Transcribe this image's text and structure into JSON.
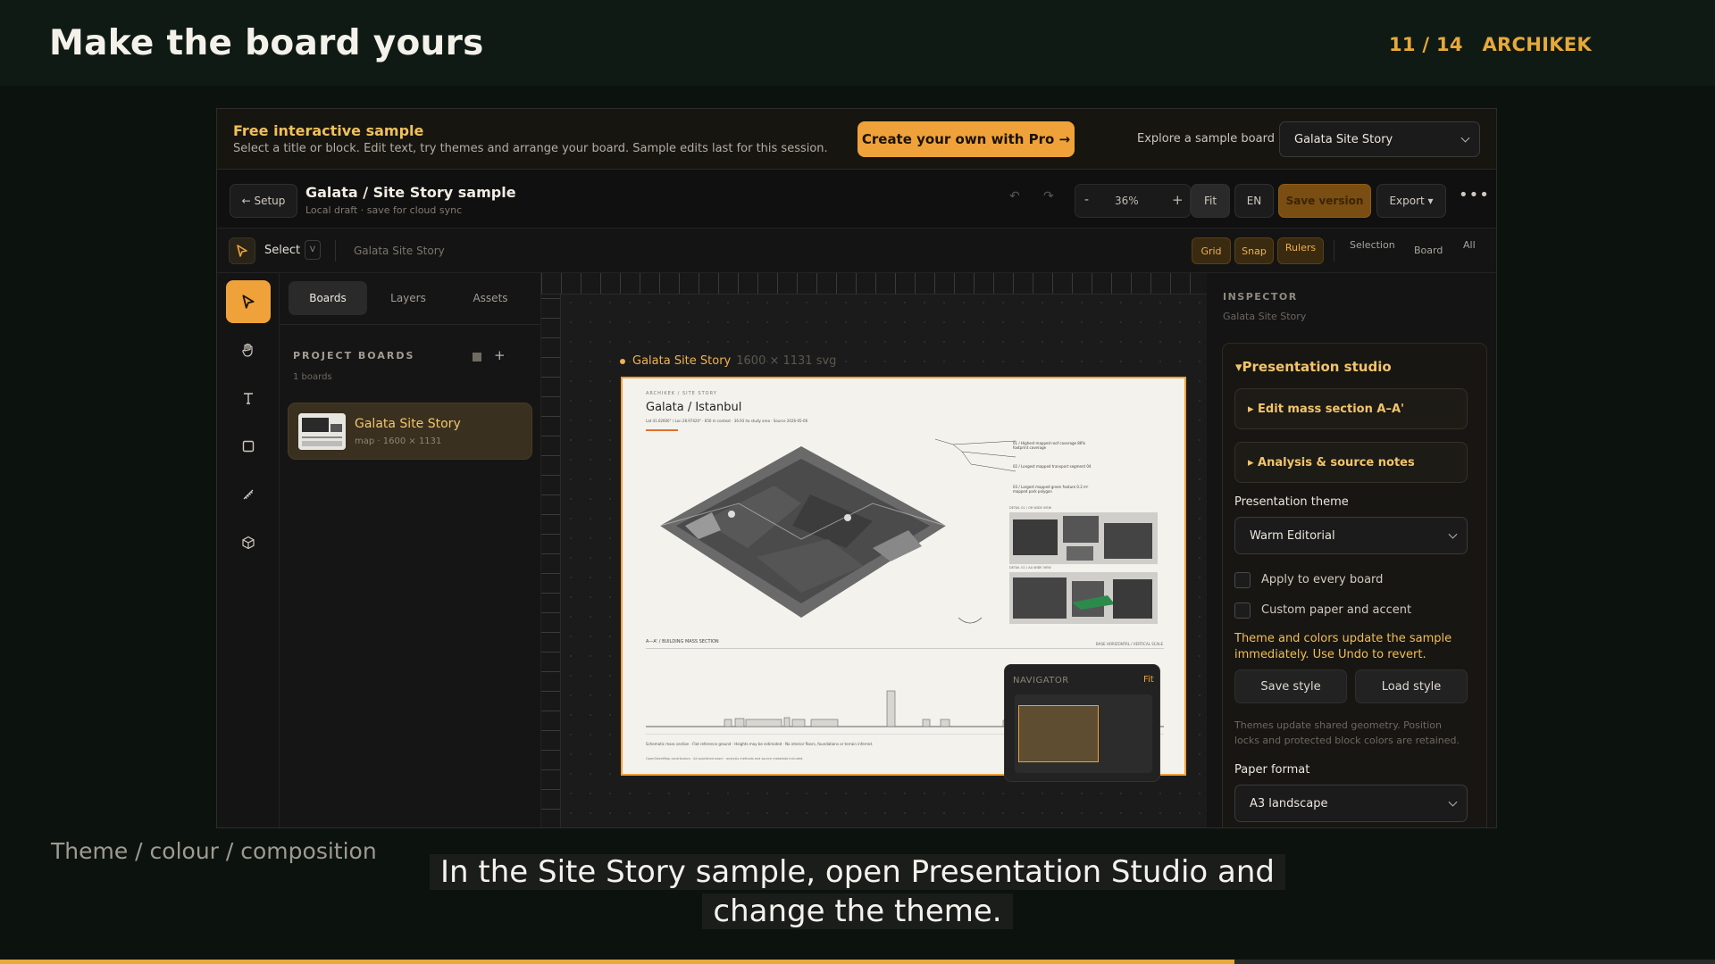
{
  "slide": {
    "title": "Make the board yours",
    "counter": "11 / 14",
    "brand": "ARCHIKEK",
    "subtitle": "Theme / colour / composition",
    "caption": "In the Site Story sample, open Presentation Studio and change the theme.",
    "progress": 0.72
  },
  "banner": {
    "title": "Free interactive sample",
    "description": "Select a title or block. Edit text, try themes and arrange your board. Sample edits last for this session.",
    "pro_button": "Create your own with Pro →",
    "explore_label": "Explore a sample board",
    "sample_select": "Galata Site Story"
  },
  "topbar": {
    "setup_button": "← Setup",
    "doc_title": "Galata / Site Story sample",
    "doc_status": "Local draft · save for cloud sync",
    "zoom_minus": "-",
    "zoom_value": "36%",
    "zoom_plus": "+",
    "fit_button": "Fit",
    "language": "EN",
    "save_version": "Save version",
    "export": "Export ▾",
    "more": "•••"
  },
  "toolbar": {
    "select_label": "Select",
    "select_shortcut": "V",
    "breadcrumb": "Galata Site Story",
    "grid": "Grid",
    "snap": "Snap",
    "rulers": "Rulers",
    "seg_selection": "Selection",
    "seg_board": "Board",
    "seg_all": "All"
  },
  "tools": [
    "select-tool",
    "hand-tool",
    "text-tool",
    "frame-tool",
    "measure-tool",
    "cube-tool"
  ],
  "left_panel": {
    "tabs": [
      {
        "label": "Boards"
      },
      {
        "label": "Layers"
      },
      {
        "label": "Assets"
      }
    ],
    "section_title": "PROJECT BOARDS",
    "count": "1 boards",
    "boards": [
      {
        "name": "Galata Site Story",
        "meta": "map · 1600 × 1131"
      }
    ]
  },
  "canvas": {
    "board_label": "Galata Site Story",
    "board_dims": "1600 × 1131 svg",
    "artboard": {
      "kicker": "ARCHIKEK / SITE STORY",
      "title": "Galata / Istanbul",
      "coords": "Lat 41.02600° / Lon 28.97420° · 650 m context · 36.93 ha study area · Source 2026-05-06",
      "legend": [
        "01 / Highest mapped roof coverage 86% footprint coverage",
        "02 / Longest mapped transport segment 04",
        "03 / Largest mapped green feature 0.2 m² mapped park polygon"
      ],
      "detail_a": "DETAIL 01 / OR WIDE VIEW",
      "detail_b": "DETAIL 02 / AA WIDE VIEW",
      "section_title": "A—A' / BUILDING MASS SECTION",
      "section_scale": "BASE HORIZONTAL / VERTICAL SCALE",
      "notes1": "Schematic mass section · Flat reference ground · Heights may be estimated · No interior floors, foundations or terrain inferred.",
      "notes2": "OpenStreetMap contributors · A4 published exam · analysis methods and source metadata included."
    },
    "navigator": {
      "title": "NAVIGATOR",
      "fit": "Fit"
    }
  },
  "inspector": {
    "title": "INSPECTOR",
    "subtitle": "Galata Site Story",
    "studio_title": "▾Presentation studio",
    "accordion_mass": "▸ Edit mass section A–A'",
    "accordion_notes": "▸ Analysis & source notes",
    "theme_label": "Presentation theme",
    "theme_value": "Warm Editorial",
    "check_every": "Apply to every board",
    "check_custom": "Custom paper and accent",
    "theme_note": "Theme and colors update the sample immediately. Use Undo to revert.",
    "save_style": "Save style",
    "load_style": "Load style",
    "geometry_note": "Themes update shared geometry. Position locks and protected block colors are retained.",
    "paper_label": "Paper format",
    "paper_value": "A3 landscape"
  },
  "colors": {
    "accent": "#f0a23a",
    "gold": "#e6a93a",
    "background": "#0c130f"
  }
}
